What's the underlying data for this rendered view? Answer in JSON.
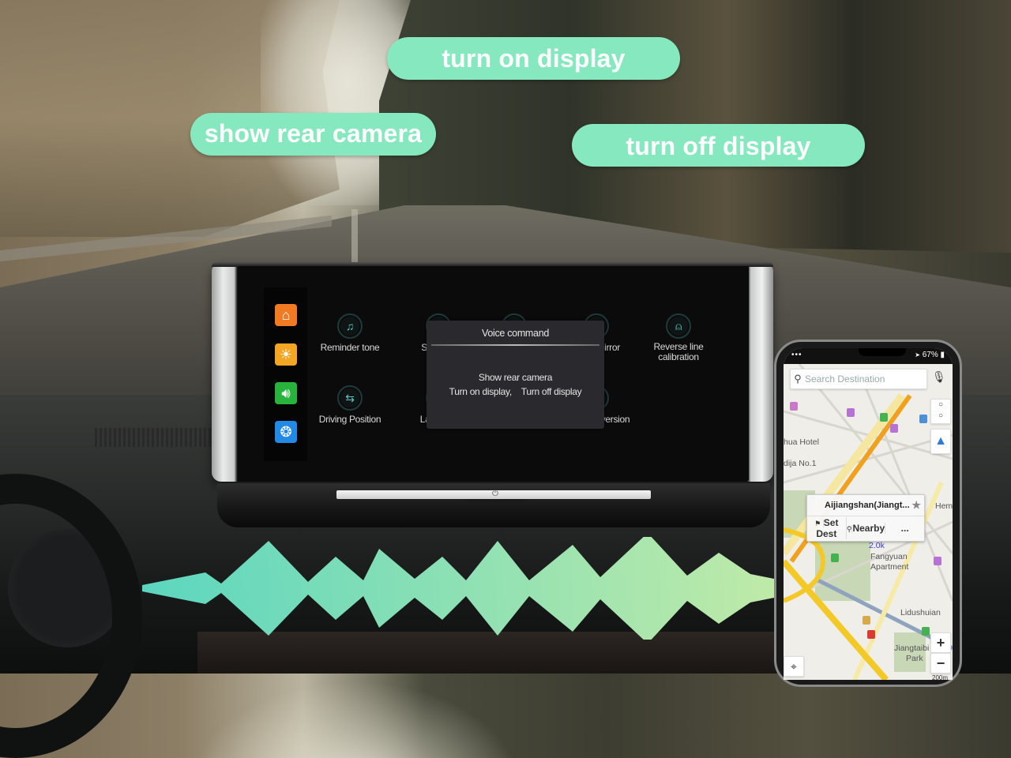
{
  "voice_prompts": [
    {
      "label": "turn on display"
    },
    {
      "label": "show rear camera"
    },
    {
      "label": "turn off display"
    }
  ],
  "device": {
    "sidebar_apps": [
      {
        "name": "home",
        "icon": "home-icon",
        "color": "#f27a22"
      },
      {
        "name": "brightness",
        "icon": "sun-icon",
        "color": "#f3a524"
      },
      {
        "name": "volume",
        "icon": "speaker-icon",
        "color": "#27b33c"
      },
      {
        "name": "camera",
        "icon": "shutter-icon",
        "color": "#2289e6"
      }
    ],
    "settings_tiles": [
      {
        "label": "Reminder tone",
        "icon": "music-note-icon"
      },
      {
        "label": "Scre",
        "icon": "screen-icon"
      },
      {
        "label": "",
        "icon": "setting-icon"
      },
      {
        "label": "irror",
        "icon": "mirror-icon"
      },
      {
        "label": "Reverse line calibration",
        "icon": "reverse-line-icon"
      },
      {
        "label": "Driving Position",
        "icon": "swap-arrows-icon"
      },
      {
        "label": "Lar",
        "icon": "language-icon"
      },
      {
        "label": "version",
        "icon": "version-icon"
      }
    ],
    "dialog": {
      "title": "Voice command",
      "line1": "Show rear camera",
      "line2": "Turn on display,    Turn off display"
    },
    "accent_color": "#5fc7c7"
  },
  "phone": {
    "status": {
      "signal": "•••",
      "battery": "67%",
      "location_arrow": "➤"
    },
    "search_placeholder": "Search Destination",
    "popup": {
      "title": "Aijiangshan(Jiangt...",
      "actions": [
        "Set Dest",
        "Nearby",
        "..."
      ]
    },
    "map_labels": [
      "hua Hotel",
      "dija No.1",
      "Hemuji",
      "2.0k",
      "Fangyuan",
      "Apartment",
      "Lidushuian",
      "Jiangtaibi",
      "Park"
    ],
    "scale": "200m",
    "zoom_in": "+",
    "zoom_out": "−"
  },
  "colors": {
    "bubble": "#86e8be",
    "wave_start": "#5fe0c8",
    "wave_end": "#c8f5b0"
  }
}
